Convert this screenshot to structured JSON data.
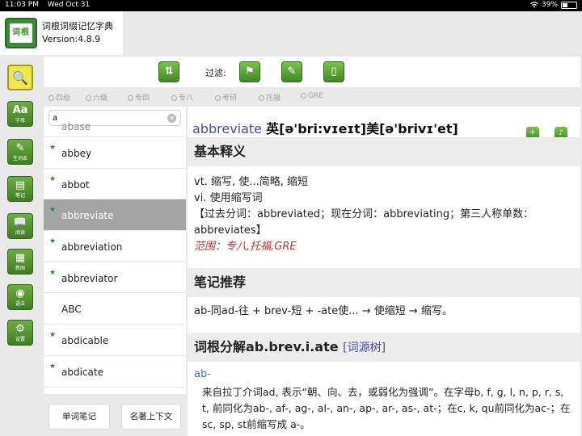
{
  "status": {
    "time": "11:03 PM",
    "date": "Wed Oct 31",
    "battery": "39%",
    "battery_level": 0.39
  },
  "app": {
    "logo_text": "词根",
    "title": "词根词缀记忆字典",
    "version": "Version:4.8.9"
  },
  "rail": [
    {
      "glyph": "🔍",
      "caption": ""
    },
    {
      "glyph": "Aa",
      "caption": "字母"
    },
    {
      "glyph": "✎",
      "caption": "生词本"
    },
    {
      "glyph": "▤",
      "caption": "笔记"
    },
    {
      "glyph": "📖",
      "caption": "阅读"
    },
    {
      "glyph": "▦",
      "caption": "新闻"
    },
    {
      "glyph": "◉",
      "caption": "语法"
    },
    {
      "glyph": "⚙",
      "caption": "设置"
    }
  ],
  "toolbar": {
    "filter_label": "过滤:"
  },
  "levels": [
    "四级",
    "六级",
    "专四",
    "专八",
    "考研",
    "托福",
    "GRE"
  ],
  "search": {
    "value": "a",
    "placeholder": ""
  },
  "list": [
    {
      "word": "abase",
      "star": false
    },
    {
      "word": "abbey",
      "star": true
    },
    {
      "word": "abbot",
      "star": true
    },
    {
      "word": "abbreviate",
      "star": true
    },
    {
      "word": "abbreviation",
      "star": true
    },
    {
      "word": "abbreviator",
      "star": true
    },
    {
      "word": "ABC",
      "star": false
    },
    {
      "word": "abdicable",
      "star": true
    },
    {
      "word": "abdicate",
      "star": true
    }
  ],
  "footer": {
    "note_button": "单词笔记",
    "context_button": "名著上下文"
  },
  "detail": {
    "headword": "abbreviate",
    "phonetic": "英[ə'bri:vɪeɪt]美[ə'brivɪ'et]",
    "sec1_title": "基本释义",
    "def1": "vt. 缩写, 使...简略, 缩短",
    "def2": "vi. 使用缩写词",
    "forms": "【过去分词：abbreviated；现在分词：abbreviating；第三人称单数：abbreviates】",
    "range": "范围：专八,托福,GRE",
    "sec2_title": "笔记推荐",
    "note": "ab-同ad-往 + brev-短 + -ate使... → 使缩短 → 缩写。",
    "sec3_title": "词根分解ab.brev.i.ate",
    "tree_link": "[词源树]",
    "root": "ab-",
    "root_desc": "来自拉丁介词ad, 表示“朝、向、去，或弱化为强调”。在字母b, f, g, l, n, p, r, s, t, 前同化为ab-, af-, ag-, al-, an-, ap-, ar-, as-, at-；在c, k, qu前同化为ac-；在sc, sp, st前缩写成 a-。"
  }
}
